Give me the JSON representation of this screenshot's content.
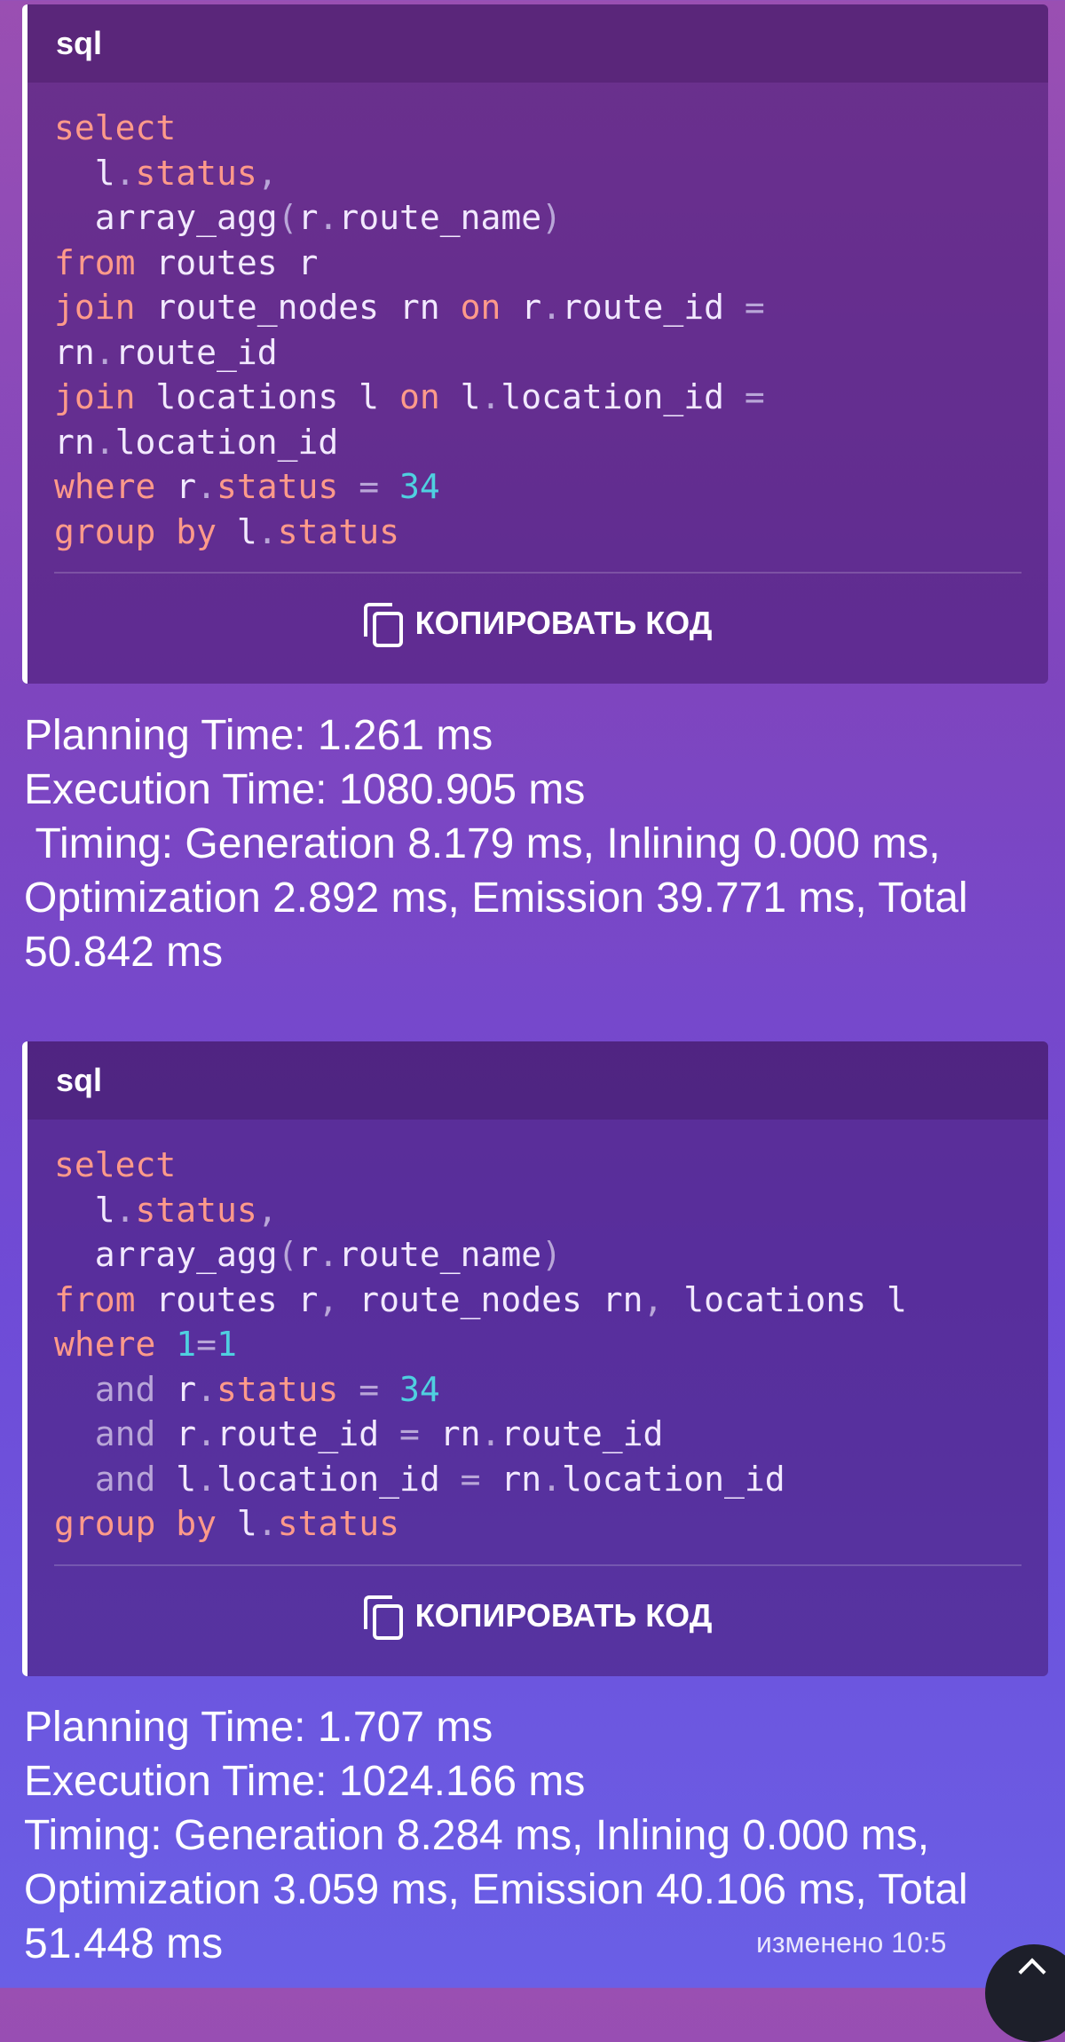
{
  "blocks": [
    {
      "lang": "sql",
      "copy_label": "КОПИРОВАТЬ КОД"
    },
    {
      "lang": "sql",
      "copy_label": "КОПИРОВАТЬ КОД"
    }
  ],
  "result1": {
    "planning": "Planning Time: 1.261 ms",
    "execution": "Execution Time: 1080.905 ms",
    "timing1": " Timing: Generation 8.179 ms, Inlining 0.000 ms,",
    "timing2": "Optimization 2.892 ms, Emission 39.771 ms, Total",
    "timing3": "50.842 ms"
  },
  "result2": {
    "planning": "Planning Time: 1.707 ms",
    "execution": "Execution Time: 1024.166 ms",
    "timing1": "Timing: Generation 8.284 ms, Inlining 0.000 ms,",
    "timing2": "Optimization 3.059 ms, Emission 40.106 ms, Total",
    "timing3": "51.448 ms"
  },
  "edited_label": "изменено 10:5",
  "colors": {
    "keyword": "#ff9a8a",
    "number": "#4fd0e0",
    "punctuation": "#b9a6d8"
  },
  "code1": {
    "l1": "select",
    "l2a": "  l",
    "l2b": ".",
    "l2c": "status",
    "l2d": ",",
    "l3a": "  array_agg",
    "l3b": "(",
    "l3c": "r",
    "l3d": ".",
    "l3e": "route_name",
    "l3f": ")",
    "l4a": "from",
    "l4b": " routes r",
    "l5a": "join",
    "l5b": " route_nodes rn ",
    "l5c": "on",
    "l5d": " r",
    "l5e": ".",
    "l5f": "route_id ",
    "l5g": "=",
    "l6a": "rn",
    "l6b": ".",
    "l6c": "route_id",
    "l7a": "join",
    "l7b": " locations l ",
    "l7c": "on",
    "l7d": " l",
    "l7e": ".",
    "l7f": "location_id ",
    "l7g": "=",
    "l8a": "rn",
    "l8b": ".",
    "l8c": "location_id",
    "l9a": "where",
    "l9b": " r",
    "l9c": ".",
    "l9d": "status",
    "l9e": " = ",
    "l9f": "34",
    "l10a": "group by",
    "l10b": " l",
    "l10c": ".",
    "l10d": "status"
  },
  "code2": {
    "l1": "select",
    "l2a": "  l",
    "l2b": ".",
    "l2c": "status",
    "l2d": ",",
    "l3a": "  array_agg",
    "l3b": "(",
    "l3c": "r",
    "l3d": ".",
    "l3e": "route_name",
    "l3f": ")",
    "l4a": "from",
    "l4b": " routes r",
    "l4c": ",",
    "l4d": " route_nodes rn",
    "l4e": ",",
    "l4f": " locations l",
    "l5a": "where",
    "l5b": " ",
    "l5c": "1",
    "l5d": "=",
    "l5e": "1",
    "l6a": "  and",
    "l6b": " r",
    "l6c": ".",
    "l6d": "status",
    "l6e": " = ",
    "l6f": "34",
    "l7a": "  and",
    "l7b": " r",
    "l7c": ".",
    "l7d": "route_id ",
    "l7e": "=",
    "l7f": " rn",
    "l7g": ".",
    "l7h": "route_id",
    "l8a": "  and",
    "l8b": " l",
    "l8c": ".",
    "l8d": "location_id ",
    "l8e": "=",
    "l8f": " rn",
    "l8g": ".",
    "l8h": "location_id",
    "l9a": "group by",
    "l9b": " l",
    "l9c": ".",
    "l9d": "status"
  }
}
